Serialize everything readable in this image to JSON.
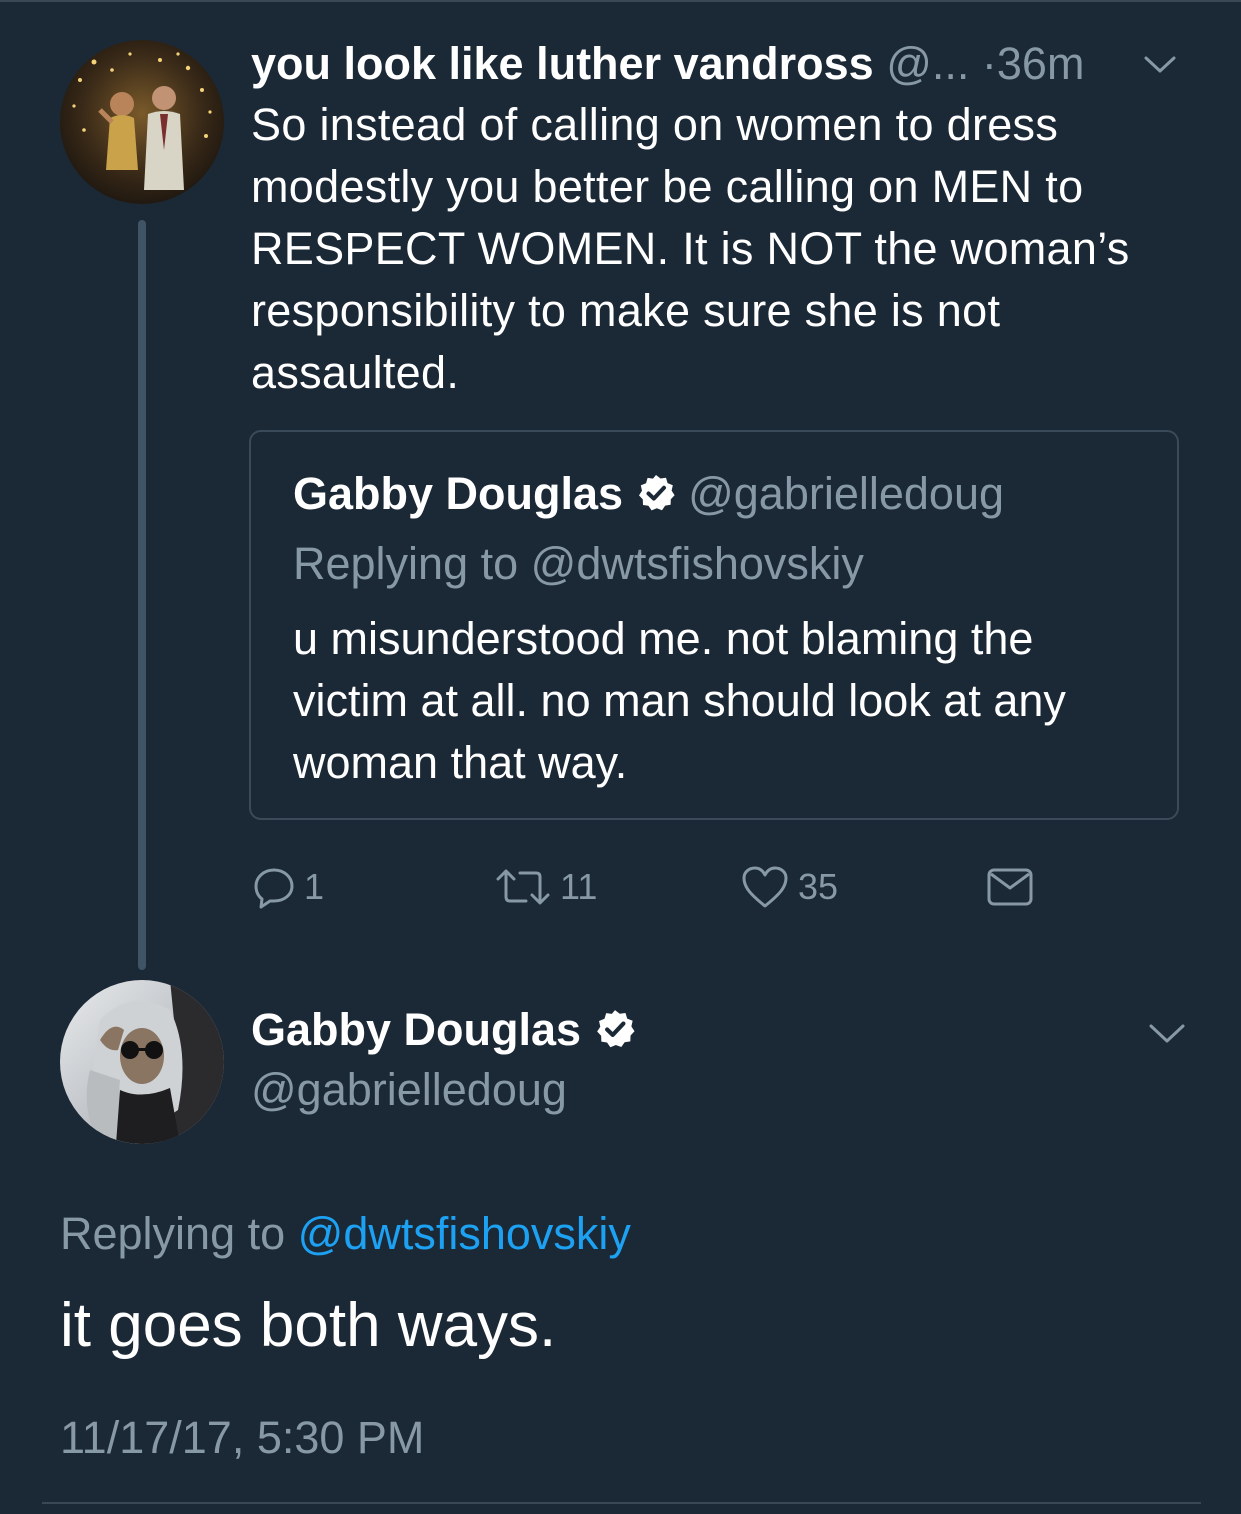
{
  "parent_tweet": {
    "display_name": "you look like luther vandross",
    "handle": "@...",
    "time": "·36m",
    "text": "So instead of calling on women to dress modestly you better be calling on MEN to RESPECT WOMEN. It is NOT the woman’s responsibility to make sure she is not assaulted.",
    "quoted_tweet": {
      "display_name": "Gabby Douglas",
      "handle": "@gabrielledoug",
      "replying_to": "Replying to @dwtsfishovskiy",
      "text": "u misunderstood me. not blaming the victim at all. no man should look at any woman that way."
    },
    "actions": {
      "reply_count": "1",
      "retweet_count": "11",
      "like_count": "35"
    }
  },
  "main_tweet": {
    "display_name": "Gabby Douglas",
    "handle": "@gabrielledoug",
    "replying_prefix": "Replying to",
    "replying_mention": "@dwtsfishovskiy",
    "text": "it goes both ways.",
    "timestamp": "11/17/17, 5:30 PM"
  },
  "icons": {
    "verified": "verified-badge-icon",
    "reply": "reply-icon",
    "retweet": "retweet-icon",
    "like": "heart-icon",
    "dm": "envelope-icon",
    "caret": "chevron-down-icon"
  },
  "colors": {
    "background": "#1b2836",
    "secondary_text": "#8899a6",
    "link": "#1da1f2",
    "thread_line": "#3f5566",
    "border": "#3b4a58"
  }
}
